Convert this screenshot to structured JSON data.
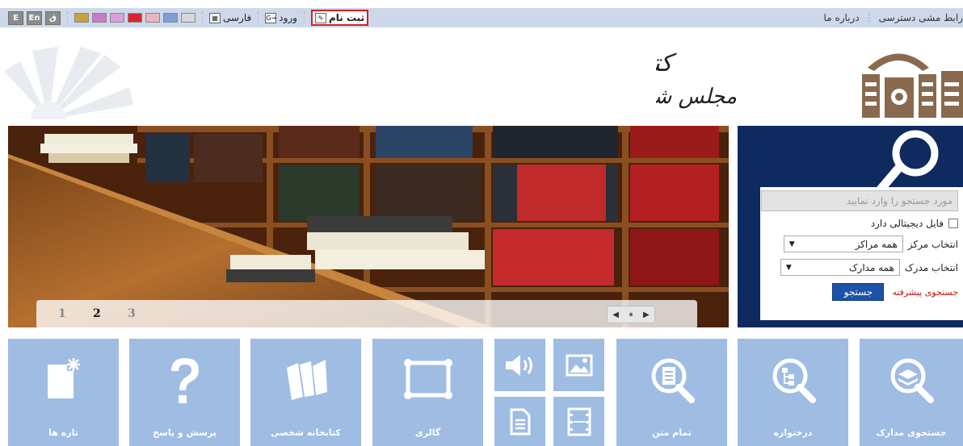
{
  "topbar": {
    "links_right": [
      "رابط مشی دسترسی",
      "درباره ما"
    ],
    "register": "ثبت نام",
    "login": "ورود",
    "language": "فارسی",
    "lang_buttons": [
      "E",
      "En",
      "ق"
    ],
    "theme_colors": [
      "#c8a03c",
      "#c77ac7",
      "#d9a0d9",
      "#d8262e",
      "#e8b6c0",
      "#7a9fd4",
      "#d7d7d7"
    ]
  },
  "logo": {
    "line1": "کتابخانه،موزه،ومرکزاسناد",
    "line2": "مجلس شورای اسلامی"
  },
  "banner": {
    "pages": [
      "1",
      "2",
      "3"
    ],
    "active_page": "2",
    "controls": [
      "◀",
      "⏸",
      "▶"
    ]
  },
  "search": {
    "placeholder": "مورد جستجو را وارد نمایید",
    "digital_file_label": "فایل دیجیتالی دارد",
    "center_label": "انتخاب مرکز",
    "center_value": "همه مراکز",
    "doc_label": "انتخاب مدرک",
    "doc_value": "همه مدارک",
    "advanced_link": "جستجوی پیشرفته",
    "submit": "جستجو"
  },
  "tiles": [
    {
      "label": "تازه ها",
      "icon": "new-items-icon"
    },
    {
      "label": "پرسش و پاسخ",
      "icon": "question-icon"
    },
    {
      "label": "کتابخانه شخصی",
      "icon": "books-icon"
    },
    {
      "label": "گالری",
      "icon": "gallery-icon"
    },
    {
      "label": "تمام متن",
      "icon": "fulltext-icon"
    },
    {
      "label": "درختواره",
      "icon": "tree-icon"
    },
    {
      "label": "جستجوی مدارک",
      "icon": "document-search-icon"
    }
  ],
  "media_tiles": [
    "audio-icon",
    "image-icon",
    "text-icon",
    "video-icon"
  ],
  "colors": {
    "tile": "#9fbce3",
    "search_panel": "#0e2a5e",
    "search_button": "#1d52a8",
    "register_highlight": "#d42020",
    "advanced_link": "#c01515"
  }
}
